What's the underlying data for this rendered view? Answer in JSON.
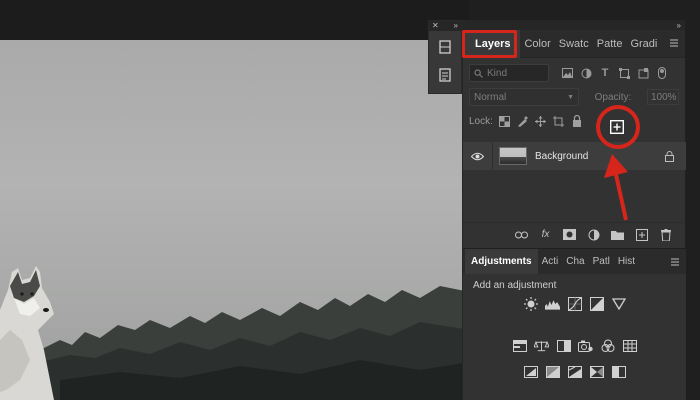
{
  "layers_panel": {
    "tabs": [
      "Layers",
      "Color",
      "Swatc",
      "Patte",
      "Gradi"
    ],
    "filter_placeholder": "Kind",
    "blend_mode": "Normal",
    "opacity_label": "Opacity:",
    "opacity_value": "100%",
    "lock_label": "Lock:",
    "layer": {
      "name": "Background"
    }
  },
  "adjustments_panel": {
    "tabs": [
      "Adjustments",
      "Acti",
      "Cha",
      "Patl",
      "Hist"
    ],
    "title": "Add an adjustment"
  },
  "colors": {
    "panel": "#323232",
    "tab_strip": "#2b2b2b",
    "annotation_red": "#d6261c"
  },
  "icons": {
    "mini_dock": [
      "libraries-icon",
      "properties-icon"
    ],
    "filters": [
      "image-filter-icon",
      "adjustment-filter-icon",
      "type-filter-icon",
      "shape-filter-icon",
      "smart-object-filter-icon",
      "filter-toggle-icon"
    ],
    "locks": [
      "lock-transparent-icon",
      "lock-image-icon",
      "lock-position-icon",
      "lock-artboard-icon",
      "lock-all-icon"
    ],
    "bottom_toolbar": [
      "link-layers-icon",
      "fx-icon",
      "add-mask-icon",
      "new-fill-adjustment-icon",
      "new-group-icon",
      "new-layer-icon",
      "delete-layer-icon"
    ]
  }
}
